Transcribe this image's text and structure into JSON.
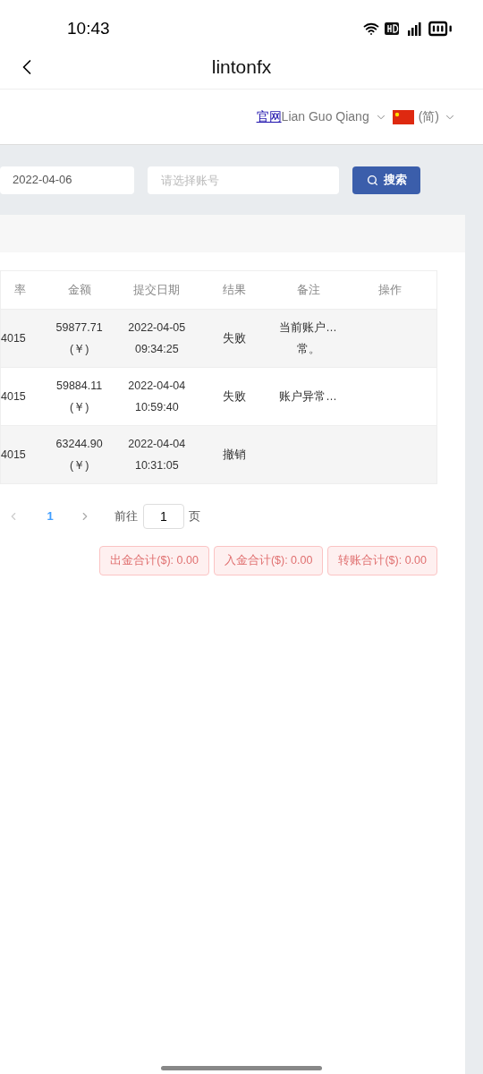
{
  "status_bar": {
    "time": "10:43"
  },
  "header": {
    "title": "lintonfx"
  },
  "top_bar": {
    "link": "官网",
    "user": "Lian Guo Qiang",
    "language": "(简)"
  },
  "filters": {
    "date": "2022-04-06",
    "account_placeholder": "请选择账号",
    "search_button": "搜索"
  },
  "table": {
    "columns": [
      "率",
      "金额",
      "提交日期",
      "结果",
      "备注",
      "操作"
    ],
    "rows": [
      {
        "rate": "4015",
        "amount": [
          "59877.71",
          "(￥)"
        ],
        "date": [
          "2022-04-05",
          "09:34:25"
        ],
        "result": "失败",
        "remark": [
          "当前账户…",
          "常。"
        ]
      },
      {
        "rate": "4015",
        "amount": [
          "59884.11",
          "(￥)"
        ],
        "date": [
          "2022-04-04",
          "10:59:40"
        ],
        "result": "失败",
        "remark": [
          "账户异常…"
        ]
      },
      {
        "rate": "4015",
        "amount": [
          "63244.90",
          "(￥)"
        ],
        "date": [
          "2022-04-04",
          "10:31:05"
        ],
        "result": "撤销",
        "remark": []
      }
    ]
  },
  "pagination": {
    "pages": [
      {
        "label": "1",
        "selected": true
      }
    ],
    "prev_disabled": true,
    "goto_label": "前往",
    "goto_value": "1",
    "page_suffix": "页"
  },
  "totals": [
    "出金合计($): 0.00",
    "入金合计($): 0.00",
    "转账合计($): 0.00"
  ]
}
